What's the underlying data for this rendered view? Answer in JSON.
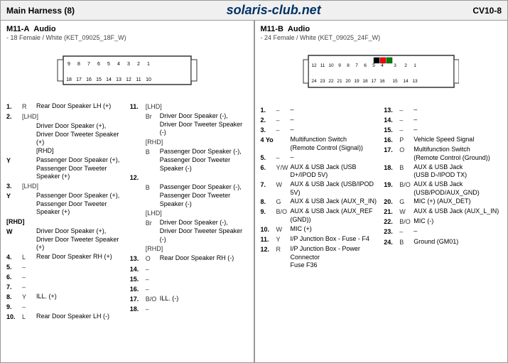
{
  "header": {
    "title": "Main Harness (8)",
    "site": "solaris-club.net",
    "code": "CV10-8"
  },
  "panelA": {
    "id": "M11-A",
    "title": "Audio",
    "subtitle": "- 18 Female / White (KET_09025_18F_W)",
    "pins": [
      {
        "num": "1.",
        "color": "R",
        "desc": "Rear Door Speaker LH (+)"
      },
      {
        "num": "2.",
        "color": "[LHD]",
        "desc": ""
      },
      {
        "num": "",
        "color": "",
        "desc": "Driver Door Speaker (+),"
      },
      {
        "num": "",
        "color": "",
        "desc": "Driver Door Tweeter Speaker (+)"
      },
      {
        "num": "",
        "color": "",
        "desc": "[RHD]"
      },
      {
        "num": "Y",
        "color": "",
        "desc": "Passenger Door Speaker (+),"
      },
      {
        "num": "",
        "color": "",
        "desc": "Passenger Door Tweeter"
      },
      {
        "num": "",
        "color": "",
        "desc": "Speaker (+)"
      },
      {
        "num": "3.",
        "color": "",
        "desc": ""
      },
      {
        "num": "[LHD]",
        "color": "",
        "desc": ""
      },
      {
        "num": "Y",
        "color": "",
        "desc": "Passenger Door Speaker (+),"
      },
      {
        "num": "",
        "color": "",
        "desc": "Passenger Door Tweeter"
      },
      {
        "num": "",
        "color": "",
        "desc": "Speaker (+)"
      },
      {
        "num": "[RHD]",
        "color": "",
        "desc": ""
      },
      {
        "num": "W",
        "color": "",
        "desc": "Driver Door Speaker (+),"
      },
      {
        "num": "",
        "color": "",
        "desc": "Driver Door Tweeter Speaker (+)"
      },
      {
        "num": "4.",
        "color": "L",
        "desc": "Rear Door Speaker RH (+)"
      },
      {
        "num": "5.",
        "color": "–",
        "desc": ""
      },
      {
        "num": "6.",
        "color": "–",
        "desc": ""
      },
      {
        "num": "7.",
        "color": "–",
        "desc": ""
      },
      {
        "num": "8.",
        "color": "Y",
        "desc": "ILL. (+)"
      },
      {
        "num": "9.",
        "color": "–",
        "desc": ""
      },
      {
        "num": "10.",
        "color": "L",
        "desc": "Rear Door Speaker LH (-)"
      }
    ],
    "pins_right": [
      {
        "num": "11.",
        "color": "[LHD]",
        "desc": ""
      },
      {
        "num": "",
        "color": "Br",
        "desc": "Driver Door Speaker (-),"
      },
      {
        "num": "",
        "color": "",
        "desc": "Driver Door Tweeter Speaker (-)"
      },
      {
        "num": "",
        "color": "[RHD]",
        "desc": ""
      },
      {
        "num": "",
        "color": "B",
        "desc": "Passenger Door Speaker (-),"
      },
      {
        "num": "",
        "color": "",
        "desc": "Passenger Door Tweeter"
      },
      {
        "num": "",
        "color": "",
        "desc": "Speaker (-)"
      },
      {
        "num": "12.",
        "color": "",
        "desc": ""
      },
      {
        "num": "",
        "color": "B",
        "desc": "Passenger Door Speaker (-),"
      },
      {
        "num": "",
        "color": "",
        "desc": "Passenger Door Tweeter Speaker (-)"
      },
      {
        "num": "",
        "color": "[LHD]",
        "desc": ""
      },
      {
        "num": "",
        "color": "Br",
        "desc": "Driver Door Speaker (-),"
      },
      {
        "num": "",
        "color": "",
        "desc": "Driver Door Tweeter Speaker (-)"
      },
      {
        "num": "",
        "color": "[RHD]",
        "desc": ""
      },
      {
        "num": "13.",
        "color": "O",
        "desc": "Rear Door Speaker RH (-)"
      },
      {
        "num": "14.",
        "color": "–",
        "desc": ""
      },
      {
        "num": "15.",
        "color": "–",
        "desc": ""
      },
      {
        "num": "16.",
        "color": "–",
        "desc": ""
      },
      {
        "num": "17.",
        "color": "B/O",
        "desc": "ILL. (-)"
      },
      {
        "num": "18.",
        "color": "–",
        "desc": ""
      }
    ]
  },
  "panelB": {
    "id": "M11-B",
    "title": "Audio",
    "subtitle": "- 24 Female / White (KET_09025_24F_W)",
    "pins": [
      {
        "num": "1.",
        "color": "–",
        "desc": "–"
      },
      {
        "num": "2.",
        "color": "–",
        "desc": "–"
      },
      {
        "num": "3.",
        "color": "–",
        "desc": "–"
      },
      {
        "num": "4.",
        "color": "Y/O",
        "desc": "Multifunction Switch (Remote Control (Signal))"
      },
      {
        "num": "5.",
        "color": "–",
        "desc": "–"
      },
      {
        "num": "6.",
        "color": "Y/W",
        "desc": "AUX & USB Jack (USB D+/IPOD 5V)"
      },
      {
        "num": "7.",
        "color": "W",
        "desc": "AUX & USB Jack (USB/IPOD 5V)"
      },
      {
        "num": "8.",
        "color": "G",
        "desc": "AUX & USB Jack (AUX_R_IN)"
      },
      {
        "num": "9.",
        "color": "B/O",
        "desc": "AUX & USB Jack (AUX_REF (GND))"
      },
      {
        "num": "10.",
        "color": "W",
        "desc": "MIC (+)"
      },
      {
        "num": "11.",
        "color": "Y",
        "desc": "I/P Junction Box - Fuse - F4"
      },
      {
        "num": "12.",
        "color": "R",
        "desc": "I/P Junction Box - Power Connector Fuse F36"
      }
    ],
    "pins_right": [
      {
        "num": "13.",
        "color": "–",
        "desc": "–"
      },
      {
        "num": "14.",
        "color": "–",
        "desc": "–"
      },
      {
        "num": "15.",
        "color": "–",
        "desc": "–"
      },
      {
        "num": "16.",
        "color": "P",
        "desc": "Vehicle Speed Signal"
      },
      {
        "num": "17.",
        "color": "O",
        "desc": "Multifunction Switch (Remote Control (Ground))"
      },
      {
        "num": "18.",
        "color": "B",
        "desc": "AUX & USB Jack (USB D-/IPOD TX)"
      },
      {
        "num": "19.",
        "color": "B/O",
        "desc": "AUX & USB Jack (USB/POD/AUX_GND)"
      },
      {
        "num": "20.",
        "color": "G",
        "desc": "MIC (+) (AUX_DET)"
      },
      {
        "num": "21.",
        "color": "W",
        "desc": "AUX & USB Jack (AUX_L_IN)"
      },
      {
        "num": "22.",
        "color": "B/O",
        "desc": "MIC (-)"
      },
      {
        "num": "23.",
        "color": "–",
        "desc": "–"
      },
      {
        "num": "24.",
        "color": "B",
        "desc": "Ground (GM01)"
      }
    ]
  }
}
